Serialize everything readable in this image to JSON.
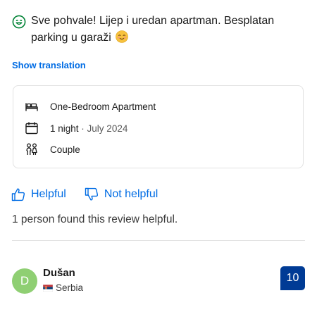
{
  "review": {
    "icon": "smile-icon",
    "text": "Sve pohvale! Lijep i uredan apartman. Besplatan parking u garaži",
    "emoji": "blush-emoji"
  },
  "show_translation": "Show translation",
  "stay": {
    "room": {
      "icon": "bed-icon",
      "label": "One-Bedroom Apartment"
    },
    "nights": {
      "icon": "calendar-icon",
      "label": "1 night",
      "separator": " · ",
      "date": "July 2024"
    },
    "traveler": {
      "icon": "couple-icon",
      "label": "Couple"
    }
  },
  "votes": {
    "helpful": {
      "icon": "thumbs-up-icon",
      "label": "Helpful"
    },
    "not_helpful": {
      "icon": "thumbs-down-icon",
      "label": "Not helpful"
    }
  },
  "helpful_count_text": "1 person found this review helpful.",
  "next_review": {
    "avatar_letter": "D",
    "name": "Dušan",
    "country": "Serbia",
    "flag": "serbia-flag",
    "score": "10"
  },
  "colors": {
    "link": "#006ce4",
    "badge": "#003b95",
    "avatar": "#8fcf73",
    "smile": "#008234"
  }
}
